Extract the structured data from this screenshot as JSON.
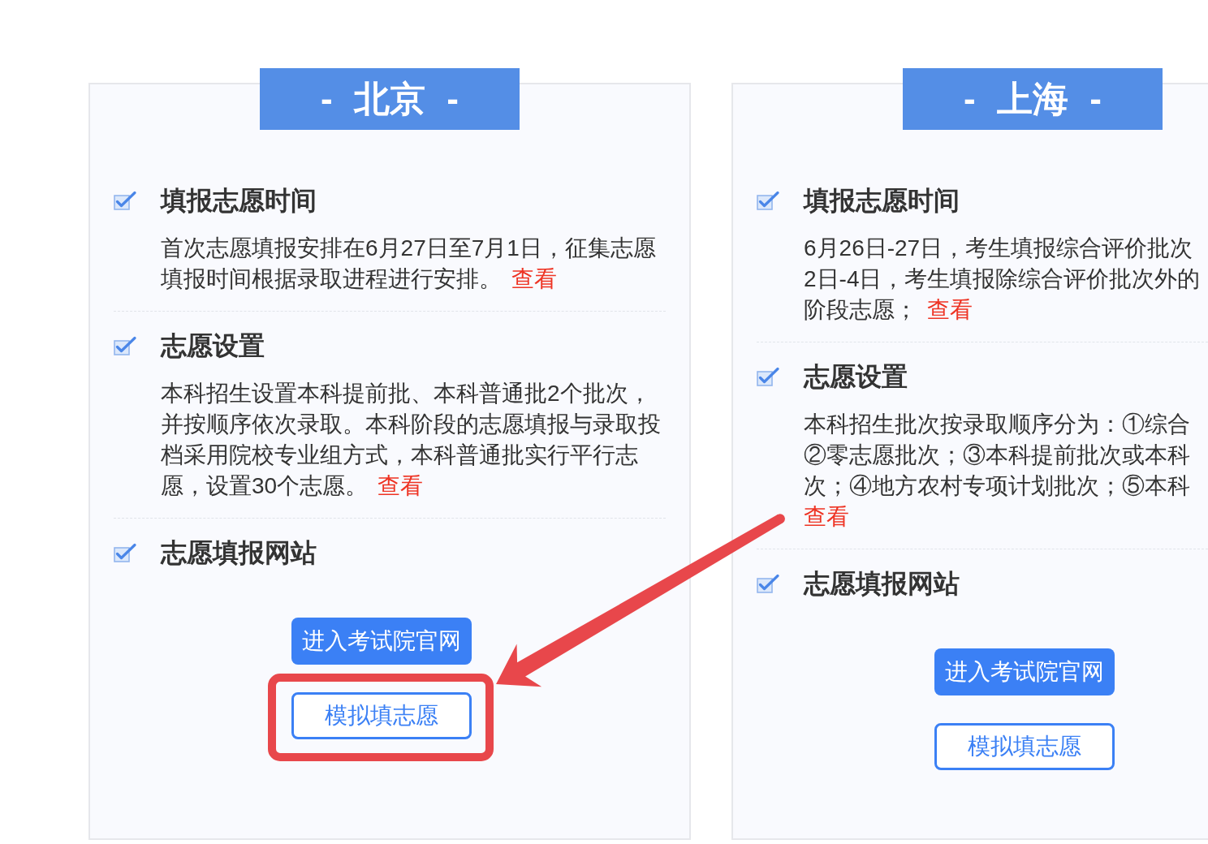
{
  "cities": [
    {
      "title": "- 北京 -",
      "cut_off": false,
      "sections": [
        {
          "heading": "填报志愿时间",
          "checked": true,
          "text": "首次志愿填报安排在6月27日至7月1日，征集志愿填报时间根据录取进程进行安排。",
          "link": "查看"
        },
        {
          "heading": "志愿设置",
          "checked": true,
          "text": "本科招生设置本科提前批、本科普通批2个批次，并按顺序依次录取。本科阶段的志愿填报与录取投档采用院校专业组方式，本科普通批实行平行志愿，设置30个志愿。",
          "link": "查看"
        },
        {
          "heading": "志愿填报网站",
          "checked": true,
          "buttons": [
            {
              "label": "进入考试院官网",
              "kind": "filled"
            },
            {
              "label": "模拟填志愿",
              "kind": "outline"
            }
          ]
        }
      ]
    },
    {
      "title": "- 上海 -",
      "cut_off": true,
      "sections": [
        {
          "heading": "填报志愿时间",
          "checked": true,
          "lines": [
            {
              "text": "6月26日-27日，考生填报综合评价批次"
            },
            {
              "text": "2日-4日，考生填报除综合评价批次外的"
            },
            {
              "text": "阶段志愿；",
              "link": "查看"
            }
          ]
        },
        {
          "heading": "志愿设置",
          "checked": true,
          "lines": [
            {
              "text": "本科招生批次按录取顺序分为：①综合"
            },
            {
              "text": "②零志愿批次；③本科提前批次或本科"
            },
            {
              "text": "次；④地方农村专项计划批次；⑤本科"
            },
            {
              "link": "查看"
            }
          ]
        },
        {
          "heading": "志愿填报网站",
          "checked": true,
          "buttons": [
            {
              "label": "进入考试院官网",
              "kind": "filled"
            },
            {
              "label": "模拟填志愿",
              "kind": "outline"
            }
          ]
        }
      ]
    }
  ]
}
